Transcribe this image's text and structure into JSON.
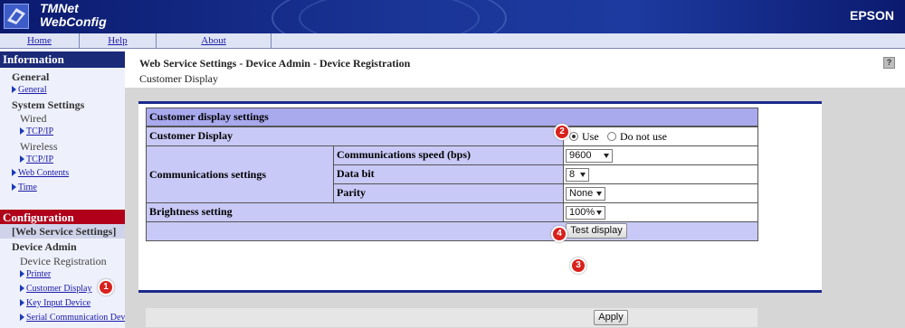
{
  "header": {
    "brand_line1": "TMNet",
    "brand_line2": "WebConfig",
    "vendor": "EPSON"
  },
  "nav": {
    "home": "Home",
    "help": "Help",
    "about": "About"
  },
  "sidebar": {
    "information": "Information",
    "general": "General",
    "general_link": "General",
    "system_settings": "System Settings",
    "wired": "Wired",
    "tcpip_wired": "TCP/IP",
    "wireless": "Wireless",
    "tcpip_wireless": "TCP/IP",
    "web_contents": "Web Contents",
    "time": "Time",
    "configuration": "Configuration",
    "web_service_settings": "[Web Service Settings]",
    "device_admin": "Device Admin",
    "device_registration": "Device Registration",
    "printer": "Printer",
    "customer_display": "Customer Display",
    "key_input_device": "Key Input Device",
    "serial_comm_device": "Serial Communication Device",
    "colors": {
      "information_bg": "#1a2a78",
      "configuration_bg": "#b0001a"
    }
  },
  "main": {
    "title": "Web Service Settings - Device Admin - Device Registration",
    "subtitle": "Customer Display",
    "help_icon": "?",
    "table": {
      "header": "Customer display settings",
      "customer_display_label": "Customer Display",
      "use_label": "Use",
      "do_not_use_label": "Do not use",
      "selected": "Use",
      "comm_settings_label": "Communications settings",
      "comm_speed_label": "Communications speed (bps)",
      "comm_speed_value": "9600",
      "data_bit_label": "Data bit",
      "data_bit_value": "8",
      "parity_label": "Parity",
      "parity_value": "None",
      "brightness_label": "Brightness setting",
      "brightness_value": "100%",
      "test_display_button": "Test display"
    },
    "apply_button": "Apply"
  },
  "badges": {
    "b1": "1",
    "b2": "2",
    "b3": "3",
    "b4": "4"
  }
}
